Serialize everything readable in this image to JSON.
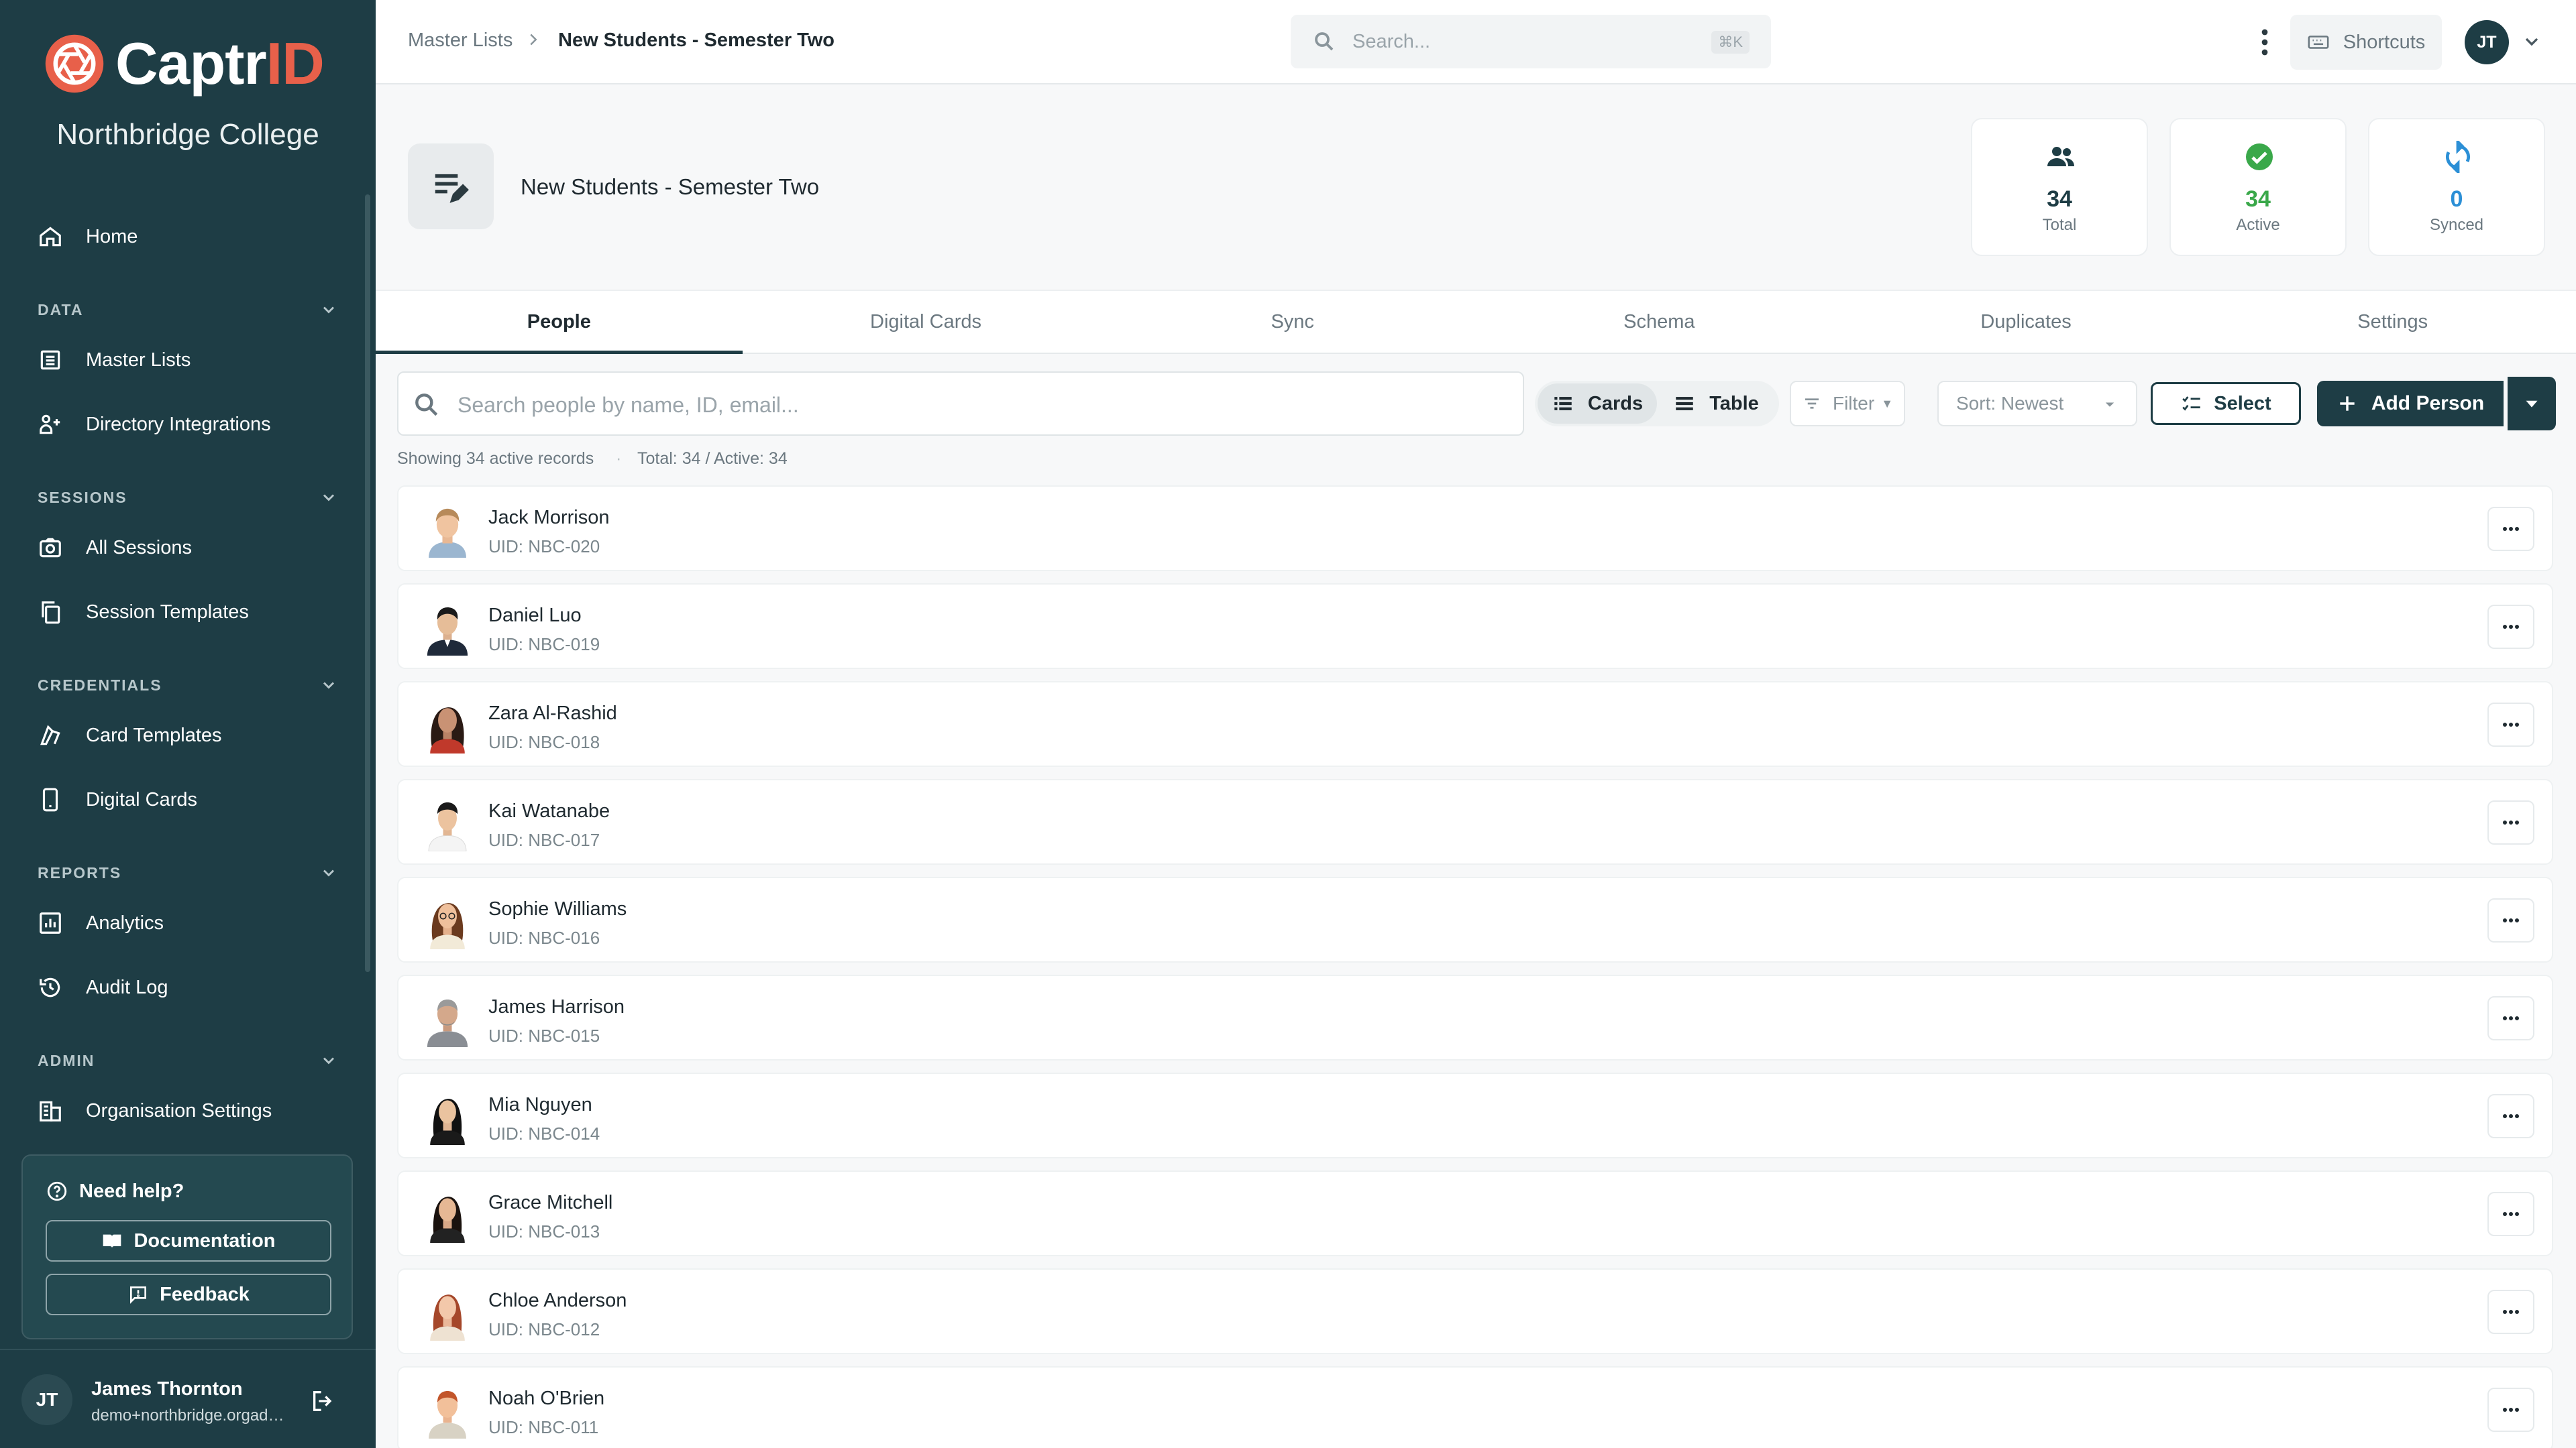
{
  "brand": {
    "name_main": "Captr",
    "name_accent": "ID",
    "org": "Northbridge College",
    "accent": "#e8604a",
    "primary": "#1e3d45"
  },
  "sidebar": {
    "home": "Home",
    "sections": [
      {
        "title": "DATA",
        "items": [
          "Master Lists",
          "Directory Integrations"
        ]
      },
      {
        "title": "SESSIONS",
        "items": [
          "All Sessions",
          "Session Templates"
        ]
      },
      {
        "title": "CREDENTIALS",
        "items": [
          "Card Templates",
          "Digital Cards"
        ]
      },
      {
        "title": "REPORTS",
        "items": [
          "Analytics",
          "Audit Log"
        ]
      },
      {
        "title": "ADMIN",
        "items": [
          "Organisation Settings"
        ]
      }
    ],
    "help": {
      "title": "Need help?",
      "documentation": "Documentation",
      "feedback": "Feedback"
    },
    "user": {
      "initials": "JT",
      "name": "James Thornton",
      "email": "demo+northbridge.orgadmin@captrid.com"
    }
  },
  "topbar": {
    "breadcrumb": [
      "Master Lists",
      "New Students - Semester Two"
    ],
    "search_placeholder": "Search...",
    "search_shortcut": "⌘K",
    "shortcuts": "Shortcuts",
    "avatar": "JT"
  },
  "header": {
    "title": "New Students - Semester Two",
    "stats": [
      {
        "value": "34",
        "label": "Total",
        "color": "#1e3d45",
        "icon": "people-icon"
      },
      {
        "value": "34",
        "label": "Active",
        "color": "#3aa84a",
        "icon": "check-circle-icon"
      },
      {
        "value": "0",
        "label": "Synced",
        "color": "#2b8fd6",
        "icon": "sync-icon"
      }
    ]
  },
  "tabs": [
    "People",
    "Digital Cards",
    "Sync",
    "Schema",
    "Duplicates",
    "Settings"
  ],
  "toolbar": {
    "search_placeholder": "Search people by name, ID, email...",
    "cards": "Cards",
    "table": "Table",
    "filter": "Filter",
    "sort": "Sort: Newest",
    "select": "Select",
    "add_person": "Add Person"
  },
  "summary": {
    "showing": "Showing 34 active records",
    "totals": "Total: 34 / Active: 34"
  },
  "people": [
    {
      "name": "Jack Morrison",
      "uid": "UID: NBC-020"
    },
    {
      "name": "Daniel Luo",
      "uid": "UID: NBC-019"
    },
    {
      "name": "Zara Al-Rashid",
      "uid": "UID: NBC-018"
    },
    {
      "name": "Kai Watanabe",
      "uid": "UID: NBC-017"
    },
    {
      "name": "Sophie Williams",
      "uid": "UID: NBC-016"
    },
    {
      "name": "James Harrison",
      "uid": "UID: NBC-015"
    },
    {
      "name": "Mia Nguyen",
      "uid": "UID: NBC-014"
    },
    {
      "name": "Grace Mitchell",
      "uid": "UID: NBC-013"
    },
    {
      "name": "Chloe Anderson",
      "uid": "UID: NBC-012"
    },
    {
      "name": "Noah O'Brien",
      "uid": "UID: NBC-011"
    }
  ]
}
